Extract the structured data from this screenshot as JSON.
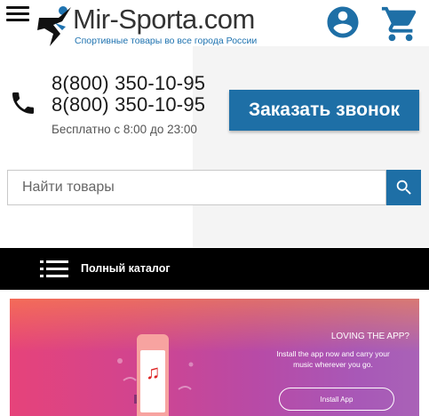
{
  "header": {
    "menu_icon": "hamburger-menu-icon",
    "logo": {
      "name": "Mir-Sporta.com",
      "tagline": "Спортивные товары во все города России"
    },
    "account_icon": "account-circle-icon",
    "cart_icon": "shopping-cart-icon"
  },
  "contacts": {
    "phone_icon": "phone-icon",
    "phones": [
      "8(800) 350-10-95",
      "8(800) 350-10-95"
    ],
    "hours": "Бесплатно с 8:00 до 23:00",
    "callback_label": "Заказать звонок"
  },
  "search": {
    "placeholder": "Найти товары",
    "value": "",
    "icon": "search-icon"
  },
  "catalog": {
    "label": "Полный каталог",
    "icon": "list-icon"
  },
  "banner": {
    "title": "LOVING THE APP?",
    "text": "Install the app now and carry your music wherever you go.",
    "button_label": "Install App"
  },
  "colors": {
    "accent": "#1e6fa6",
    "catalog_bar": "#000000",
    "logo_tagline": "#1f73b0"
  }
}
